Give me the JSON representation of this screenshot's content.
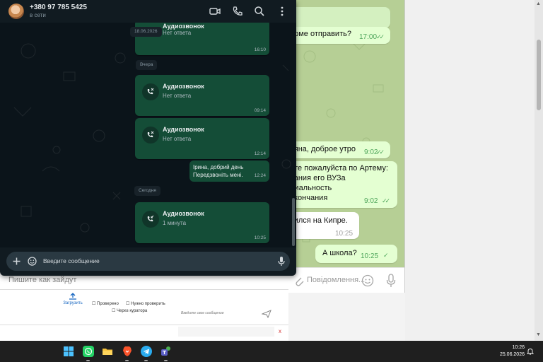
{
  "whatsapp": {
    "contact_name": "+380 97 785 5425",
    "status": "в сети",
    "messages": [
      {
        "title": "Аудиозвонок",
        "subtitle": "Нет ответа",
        "time": "16:10"
      },
      {
        "title": "Аудиозвонок",
        "subtitle": "Нет ответа",
        "time": "09:14"
      },
      {
        "title": "Аудиозвонок",
        "subtitle": "Нет ответа",
        "time": "12:14"
      },
      {
        "line1": "Ірина, добрий день",
        "line2": "Передзвоніть мені.",
        "time": "12:24"
      },
      {
        "title": "Аудиозвонок",
        "subtitle": "1 минута",
        "time": "10:25"
      }
    ],
    "date_labels": {
      "d1": "18.06.2026",
      "d2": "Вчера",
      "d3": "Сегодня"
    },
    "input_placeholder": "Введите сообщение",
    "colors": {
      "bg": "#0b141a",
      "bubble": "#144d37",
      "header": "#111b21"
    }
  },
  "telegram": {
    "messages": [
      {
        "text": "орме отправить?",
        "time": "17:00"
      },
      {
        "text": "ьяна, доброе утро",
        "time": "9:02"
      },
      {
        "lines": [
          "ите пожалуйста по Артему:",
          "вания его ВУЗа",
          "диальность",
          "окончания"
        ],
        "time": "9:02"
      },
      {
        "text": "чился на Кипре.",
        "time": "10:25"
      },
      {
        "text": "А школа?",
        "time": "10:25"
      }
    ],
    "input_placeholder": "Повідомлення...",
    "colors": {
      "bg": "#b6cf95",
      "bubble_out": "#e4ffd2",
      "check": "#4fa65b"
    }
  },
  "background_page": {
    "compose_placeholder": "Пишите как зайдут",
    "checkbox_checked": "Проверено",
    "checkbox_needs": "Нужно проверить",
    "checkbox_curator": "Через куратора",
    "description_placeholder": "Введите свое сообщение",
    "upload_label": "Загрузить",
    "close_symbol": "x"
  },
  "taskbar": {
    "time": "10:26",
    "date": "25.06.2026",
    "apps": [
      "start-icon",
      "whatsapp-icon",
      "file-explorer-icon",
      "brave-icon",
      "telegram-icon",
      "teams-icon"
    ]
  }
}
